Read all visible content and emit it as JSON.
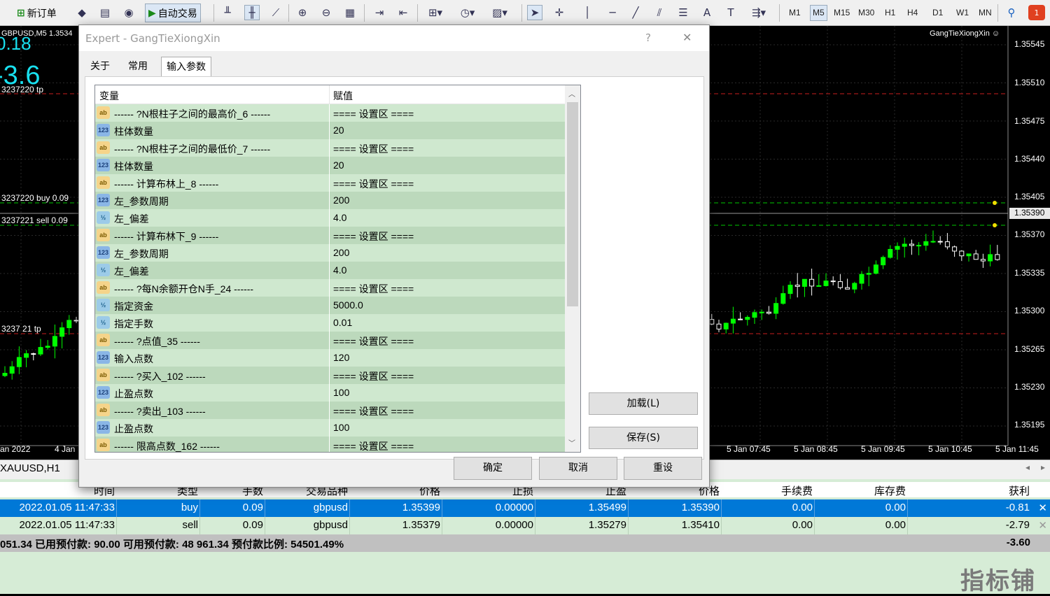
{
  "toolbar": {
    "new_order": "新订单",
    "auto_trading": "自动交易",
    "timeframes": [
      "M1",
      "M5",
      "M15",
      "M30",
      "H1",
      "H4",
      "D1",
      "W1",
      "MN"
    ],
    "active_timeframe": "M5",
    "alerts_count": "1"
  },
  "chart": {
    "symbol_label": "GBPUSD,M5  1.3534",
    "ea_label": "GangTieXiongXin ☺",
    "big_value_1": "0.18",
    "big_value_2": "-3.6",
    "line_labels": [
      "3237220 tp",
      "3237220 buy 0.09",
      "3237221 sell 0.09",
      "3237  21 tp"
    ],
    "price_labels": [
      "1.35545",
      "1.35510",
      "1.35475",
      "1.35440",
      "1.35405",
      "1.35390",
      "1.35370",
      "1.35335",
      "1.35300",
      "1.35265",
      "1.35230",
      "1.35195"
    ],
    "current_price": "1.35390",
    "time_labels_left": [
      "an 2022",
      "4 Jan"
    ],
    "time_labels_right": [
      "5 Jan 07:45",
      "5 Jan 08:45",
      "5 Jan 09:45",
      "5 Jan 10:45",
      "5 Jan 11:45"
    ],
    "colors": {
      "bull": "#00ff00",
      "bear": "#ffffff",
      "line_red": "#c81e1e",
      "line_green": "#00c800"
    }
  },
  "chart_tab": "XAUUSD,H1",
  "terminal": {
    "headers": [
      "时间",
      "类型",
      "手数",
      "交易品种",
      "价格",
      "止损",
      "止盈",
      "价格",
      "手续费",
      "库存费",
      "获利"
    ],
    "rows": [
      [
        "2022.01.05 11:47:33",
        "buy",
        "0.09",
        "gbpusd",
        "1.35399",
        "0.00000",
        "1.35499",
        "1.35390",
        "0.00",
        "0.00",
        "-0.81"
      ],
      [
        "2022.01.05 11:47:33",
        "sell",
        "0.09",
        "gbpusd",
        "1.35379",
        "0.00000",
        "1.35279",
        "1.35410",
        "0.00",
        "0.00",
        "-2.79"
      ]
    ],
    "summary": "051.34  已用预付款: 90.00  可用预付款: 48 961.34  预付款比例: 54501.49%",
    "total": "-3.60",
    "selected_color": "#0078d7"
  },
  "dialog": {
    "title": "Expert - GangTieXiongXin",
    "help": "?",
    "close": "✕",
    "tabs": [
      "关于",
      "常用",
      "输入参数"
    ],
    "active_tab": "输入参数",
    "col_variable": "变量",
    "col_value": "赋值",
    "params": [
      {
        "type": "ab",
        "name": "------ ?N根柱子之间的最高价_6 ------",
        "value": "==== 设置区 ===="
      },
      {
        "type": "123",
        "name": "柱体数量",
        "value": "20"
      },
      {
        "type": "ab",
        "name": "------ ?N根柱子之间的最低价_7 ------",
        "value": "==== 设置区 ===="
      },
      {
        "type": "123",
        "name": "柱体数量",
        "value": "20"
      },
      {
        "type": "ab",
        "name": "------ 计算布林上_8 ------",
        "value": "==== 设置区 ===="
      },
      {
        "type": "123",
        "name": "左_参数周期",
        "value": "200"
      },
      {
        "type": "v2",
        "name": "左_偏差",
        "value": "4.0"
      },
      {
        "type": "ab",
        "name": "------ 计算布林下_9 ------",
        "value": "==== 设置区 ===="
      },
      {
        "type": "123",
        "name": "左_参数周期",
        "value": "200"
      },
      {
        "type": "v2",
        "name": "左_偏差",
        "value": "4.0"
      },
      {
        "type": "ab",
        "name": "------ ?每N余额开仓N手_24 ------",
        "value": "==== 设置区 ===="
      },
      {
        "type": "v2",
        "name": "指定资金",
        "value": "5000.0"
      },
      {
        "type": "v2",
        "name": "指定手数",
        "value": "0.01"
      },
      {
        "type": "ab",
        "name": "------ ?点值_35 ------",
        "value": "==== 设置区 ===="
      },
      {
        "type": "123",
        "name": "输入点数",
        "value": "120"
      },
      {
        "type": "ab",
        "name": "------ ?买入_102 ------",
        "value": "==== 设置区 ===="
      },
      {
        "type": "123",
        "name": "止盈点数",
        "value": "100"
      },
      {
        "type": "ab",
        "name": "------ ?卖出_103 ------",
        "value": "==== 设置区 ===="
      },
      {
        "type": "123",
        "name": "止盈点数",
        "value": "100"
      },
      {
        "type": "ab",
        "name": "------ 限高点数_162 ------",
        "value": "==== 设置区 ===="
      }
    ],
    "load_button": "加载(L)",
    "save_button": "保存(S)",
    "ok_button": "确定",
    "cancel_button": "取消",
    "reset_button": "重设"
  },
  "watermark": "指标铺"
}
